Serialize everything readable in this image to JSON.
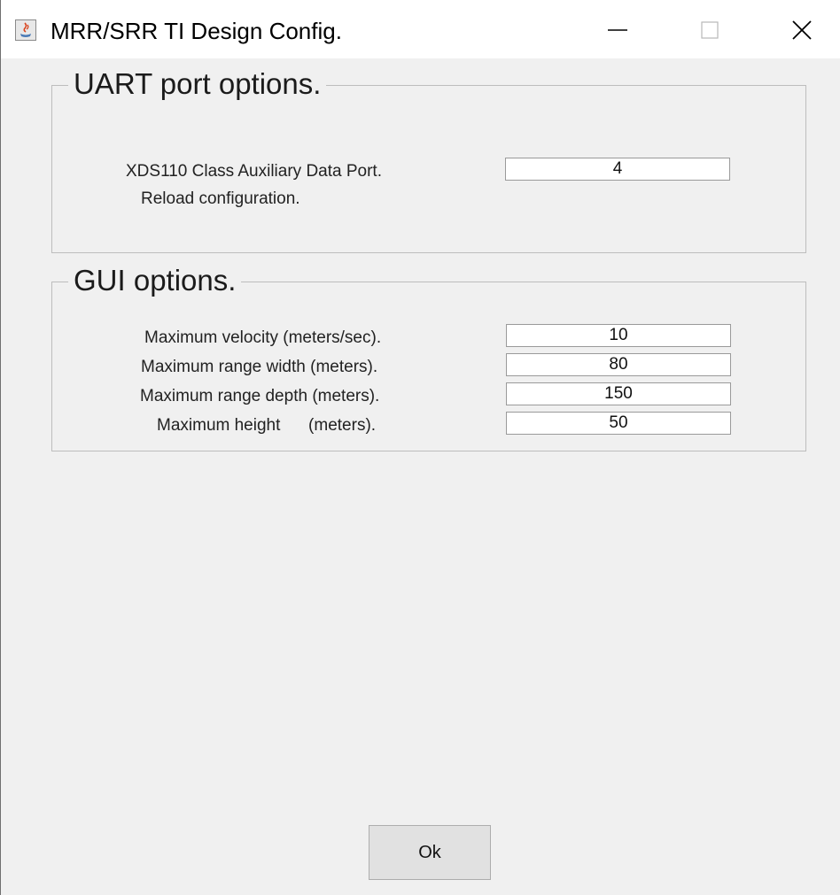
{
  "window": {
    "title": "MRR/SRR TI Design Config.",
    "controls": {
      "minimize_icon": "minimize-icon",
      "maximize_icon": "maximize-icon",
      "close_icon": "close-icon"
    }
  },
  "uart_group": {
    "title": "UART port options.",
    "port_label": "XDS110 Class Auxiliary Data Port.",
    "port_value": "4",
    "reload_label": "Reload configuration."
  },
  "gui_group": {
    "title": "GUI options.",
    "fields": [
      {
        "label": "Maximum velocity (meters/sec).",
        "value": "10"
      },
      {
        "label": "Maximum range width (meters).",
        "value": "80"
      },
      {
        "label": "Maximum range depth (meters).",
        "value": "150"
      },
      {
        "label": "Maximum height      (meters).",
        "value": "50"
      }
    ]
  },
  "footer": {
    "ok_label": "Ok"
  },
  "colors": {
    "window_bg": "#f0f0f0",
    "titlebar_bg": "#ffffff",
    "group_border": "#bdbdbd",
    "button_bg": "#e1e1e1"
  }
}
